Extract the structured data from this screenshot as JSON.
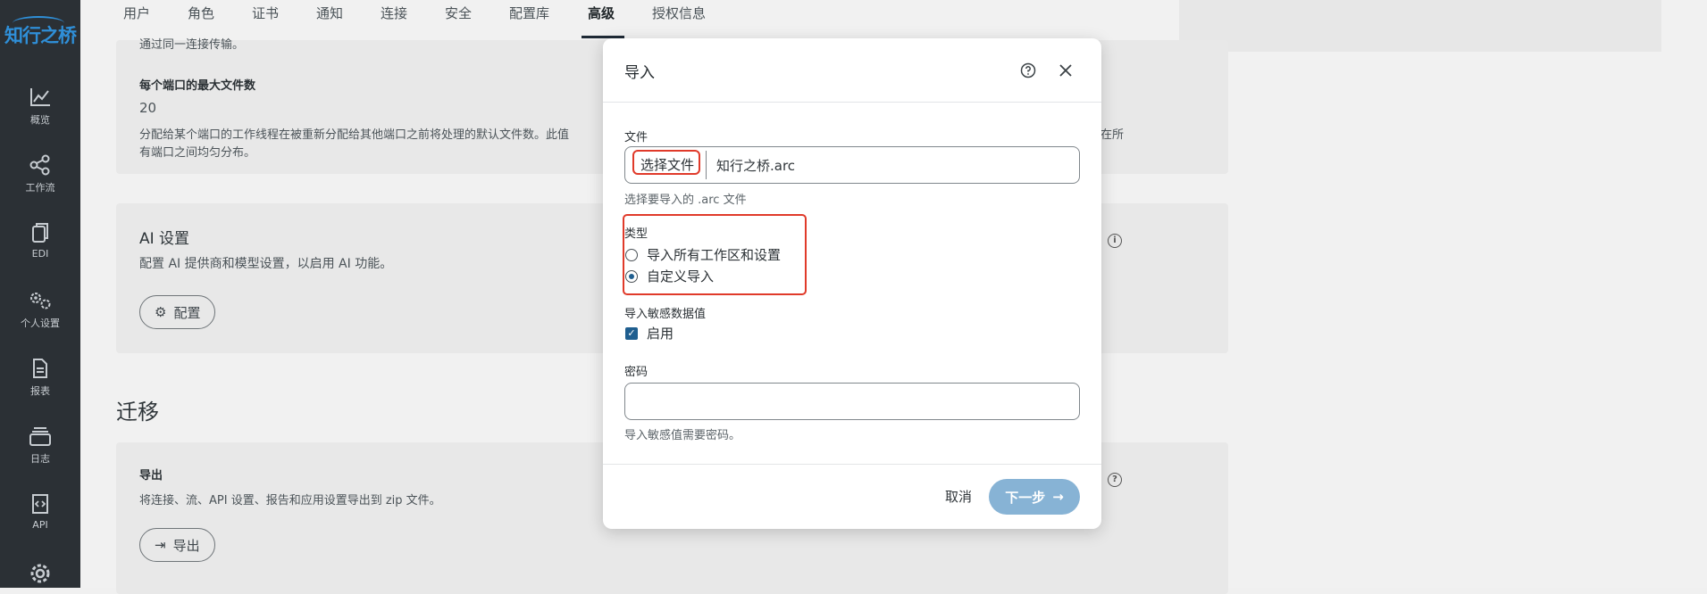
{
  "brand": {
    "logo_text": "知行之桥"
  },
  "sidebar": {
    "items": [
      {
        "label": "概览",
        "icon": "chart-line-icon"
      },
      {
        "label": "工作流",
        "icon": "share-nodes-icon"
      },
      {
        "label": "EDI",
        "icon": "documents-icon"
      },
      {
        "label": "个人设置",
        "icon": "gears-icon"
      },
      {
        "label": "报表",
        "icon": "report-icon"
      },
      {
        "label": "日志",
        "icon": "stack-icon"
      },
      {
        "label": "API",
        "icon": "api-file-icon"
      },
      {
        "label": "",
        "icon": "settings-gear-icon"
      }
    ]
  },
  "tabs": [
    {
      "label": "用户"
    },
    {
      "label": "角色"
    },
    {
      "label": "证书"
    },
    {
      "label": "通知"
    },
    {
      "label": "连接"
    },
    {
      "label": "安全"
    },
    {
      "label": "配置库"
    },
    {
      "label": "高级",
      "active": true
    },
    {
      "label": "授权信息"
    }
  ],
  "background": {
    "top_text": "通过同一连接传输。",
    "max_files_label": "每个端口的最大文件数",
    "max_files_value": "20",
    "max_files_desc_1": "分配给某个端口的工作线程在被重新分配给其他端口之前将处理的默认文件数。此值",
    "max_files_desc_right": "在所",
    "max_files_desc_2": "有端口之间均匀分布。",
    "ai_title": "AI 设置",
    "ai_desc": "配置 AI 提供商和模型设置，以启用 AI 功能。",
    "ai_button": "配置",
    "migration_title": "迁移",
    "export_label": "导出",
    "export_desc": "将连接、流、API 设置、报告和应用设置导出到 zip 文件。",
    "export_button": "导出"
  },
  "dialog": {
    "title": "导入",
    "file_label": "文件",
    "choose_button": "选择文件",
    "file_name": "知行之桥.arc",
    "file_help": "选择要导入的 .arc 文件",
    "type_label": "类型",
    "type_options": [
      {
        "label": "导入所有工作区和设置",
        "selected": false
      },
      {
        "label": "自定义导入",
        "selected": true
      }
    ],
    "sensitive_label": "导入敏感数据值",
    "sensitive_checkbox": "启用",
    "sensitive_checked": true,
    "password_label": "密码",
    "password_value": "",
    "password_help": "导入敏感值需要密码。",
    "cancel_button": "取消",
    "next_button": "下一步"
  },
  "colors": {
    "accent": "#1f5e8f",
    "highlight": "#e03a2a",
    "sidebar_bg": "#2b3035",
    "next_btn": "#87b3d5"
  }
}
